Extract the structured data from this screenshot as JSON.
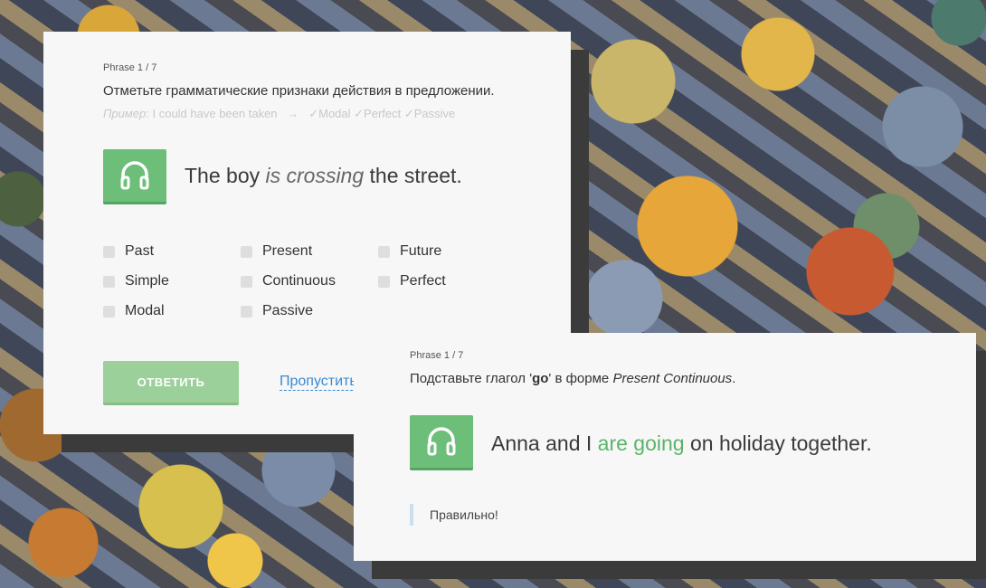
{
  "card1": {
    "counter": "Phrase 1 / 7",
    "instruction": "Отметьте грамматические признаки действия в предложении.",
    "example": {
      "label": "Пример",
      "text": ": I could have been taken",
      "arrow": "→",
      "tags": "✓Modal ✓Perfect ✓Passive"
    },
    "sentence": {
      "before": "The boy ",
      "highlight": "is crossing",
      "after": " the street."
    },
    "options": [
      "Past",
      "Present",
      "Future",
      "Simple",
      "Continuous",
      "Perfect",
      "Modal",
      "Passive"
    ],
    "answer_label": "ОТВЕТИТЬ",
    "skip_label": "Пропустить"
  },
  "card2": {
    "counter": "Phrase 1 / 7",
    "instruction": {
      "before": "Подставьте глагол '",
      "verb": "go",
      "middle": "' в форме ",
      "tense": "Present Continuous",
      "after": "."
    },
    "sentence": {
      "before": "Anna and I ",
      "answer": "are going",
      "after": " on holiday together."
    },
    "feedback": "Правильно!"
  },
  "colors": {
    "accent_green": "#6cbe78",
    "answer_green": "#5bb46a",
    "link_blue": "#3a8ad0"
  },
  "icons": {
    "audio": "headphones-icon"
  }
}
